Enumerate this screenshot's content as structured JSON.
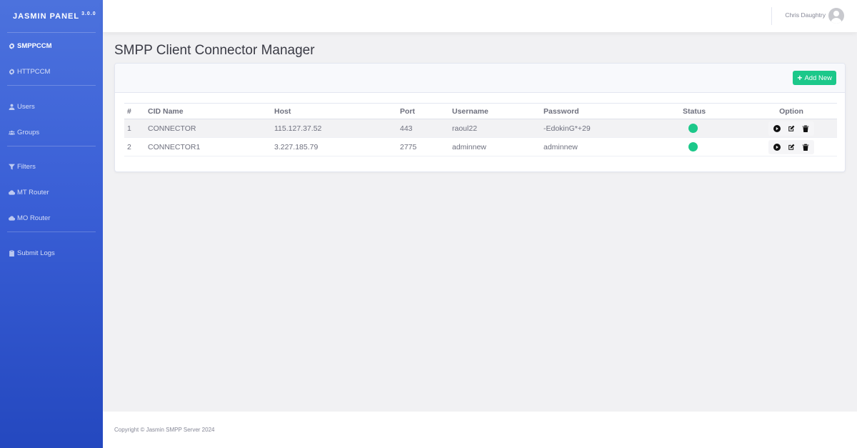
{
  "brand": {
    "name": "JASMIN PANEL",
    "version": "3.0.0"
  },
  "sidebar": {
    "items": [
      {
        "label": "SMPPCCM",
        "icon": "gear-icon",
        "active": true
      },
      {
        "label": "HTTPCCM",
        "icon": "gear-icon",
        "active": false
      },
      {
        "label": "Users",
        "icon": "user-icon",
        "active": false
      },
      {
        "label": "Groups",
        "icon": "users-icon",
        "active": false
      },
      {
        "label": "Filters",
        "icon": "filter-icon",
        "active": false
      },
      {
        "label": "MT Router",
        "icon": "cloud-icon",
        "active": false
      },
      {
        "label": "MO Router",
        "icon": "cloud-icon",
        "active": false
      },
      {
        "label": "Submit Logs",
        "icon": "clipboard-icon",
        "active": false
      }
    ]
  },
  "topbar": {
    "user_name": "Chris Daughtry",
    "avatar_icon": "avatar-icon"
  },
  "main": {
    "title": "SMPP Client Connector Manager",
    "add_button": "Add New",
    "table": {
      "headers": [
        "#",
        "CID Name",
        "Host",
        "Port",
        "Username",
        "Password",
        "Status",
        "Option"
      ],
      "rows": [
        {
          "num": "1",
          "cid": "CONNECTOR",
          "host": "115.127.37.52",
          "port": "443",
          "username": "raoul22",
          "password": "-EdokinG*+29",
          "status": "online"
        },
        {
          "num": "2",
          "cid": "CONNECTOR1",
          "host": "3.227.185.79",
          "port": "2775",
          "username": "adminnew",
          "password": "adminnew",
          "status": "online"
        }
      ],
      "row_actions": [
        "play-icon",
        "edit-icon",
        "trash-icon"
      ]
    }
  },
  "footer": {
    "text": "Copyright © Jasmin SMPP Server 2024"
  },
  "colors": {
    "accent": "#1cc88a",
    "sidebar_top": "#4c72dd",
    "sidebar_bottom": "#2448bf"
  }
}
